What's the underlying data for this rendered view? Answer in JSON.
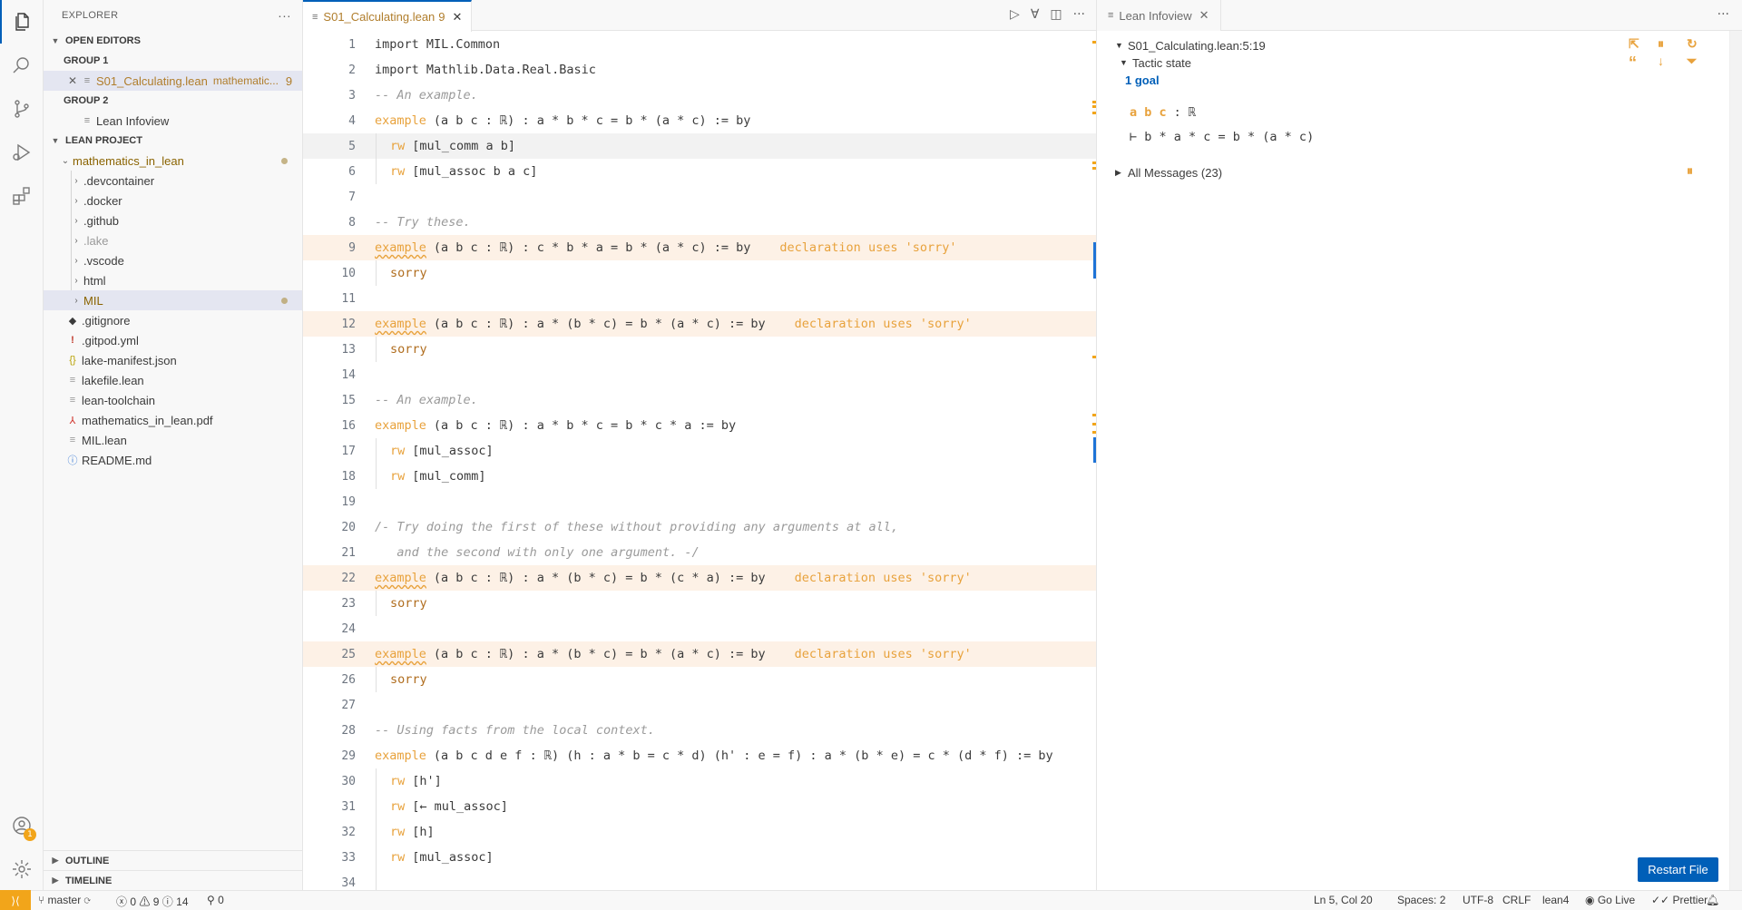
{
  "sidebar": {
    "title": "EXPLORER",
    "more": "···",
    "open_editors": "OPEN EDITORS",
    "group1": "GROUP 1",
    "group1_file": "S01_Calculating.lean",
    "group1_path": "mathematic...",
    "group1_count": "9",
    "group2": "GROUP 2",
    "group2_file": "Lean Infoview",
    "project": "LEAN PROJECT",
    "root_folder": "mathematics_in_lean",
    "items": [
      {
        "label": ".devcontainer",
        "kind": "folder"
      },
      {
        "label": ".docker",
        "kind": "folder"
      },
      {
        "label": ".github",
        "kind": "folder"
      },
      {
        "label": ".lake",
        "kind": "folder"
      },
      {
        "label": ".vscode",
        "kind": "folder"
      },
      {
        "label": "html",
        "kind": "folder"
      },
      {
        "label": "MIL",
        "kind": "folder"
      },
      {
        "label": ".gitignore",
        "kind": "file"
      },
      {
        "label": ".gitpod.yml",
        "kind": "file"
      },
      {
        "label": "lake-manifest.json",
        "kind": "file"
      },
      {
        "label": "lakefile.lean",
        "kind": "file"
      },
      {
        "label": "lean-toolchain",
        "kind": "file"
      },
      {
        "label": "mathematics_in_lean.pdf",
        "kind": "file"
      },
      {
        "label": "MIL.lean",
        "kind": "file"
      },
      {
        "label": "README.md",
        "kind": "file"
      }
    ],
    "outline": "OUTLINE",
    "timeline": "TIMELINE",
    "accounts_badge": "1"
  },
  "editor": {
    "tab_label": "S01_Calculating.lean",
    "tab_count": "9",
    "lines": [
      {
        "n": "1",
        "kind": "import",
        "text": "import MIL.Common"
      },
      {
        "n": "2",
        "kind": "import",
        "text": "import Mathlib.Data.Real.Basic"
      },
      {
        "n": "3",
        "kind": "comment",
        "text": "-- An example."
      },
      {
        "n": "4",
        "kind": "example",
        "text": "(a b c : ℝ) : a * b * c = b * (a * c) := by"
      },
      {
        "n": "5",
        "kind": "tactic",
        "text": "[mul_comm a b]"
      },
      {
        "n": "6",
        "kind": "tactic",
        "text": "[mul_assoc b a c]"
      },
      {
        "n": "7",
        "kind": "blank",
        "text": ""
      },
      {
        "n": "8",
        "kind": "comment",
        "text": "-- Try these."
      },
      {
        "n": "9",
        "kind": "sorry_example",
        "text": "(a b c : ℝ) : c * b * a = b * (a * c) := by"
      },
      {
        "n": "10",
        "kind": "sorry",
        "text": "sorry"
      },
      {
        "n": "11",
        "kind": "blank",
        "text": ""
      },
      {
        "n": "12",
        "kind": "sorry_example",
        "text": "(a b c : ℝ) : a * (b * c) = b * (a * c) := by"
      },
      {
        "n": "13",
        "kind": "sorry",
        "text": "sorry"
      },
      {
        "n": "14",
        "kind": "blank",
        "text": ""
      },
      {
        "n": "15",
        "kind": "comment",
        "text": "-- An example."
      },
      {
        "n": "16",
        "kind": "example",
        "text": "(a b c : ℝ) : a * b * c = b * c * a := by"
      },
      {
        "n": "17",
        "kind": "tactic",
        "text": "[mul_assoc]"
      },
      {
        "n": "18",
        "kind": "tactic",
        "text": "[mul_comm]"
      },
      {
        "n": "19",
        "kind": "blank",
        "text": ""
      },
      {
        "n": "20",
        "kind": "comment",
        "text": "/- Try doing the first of these without providing any arguments at all,"
      },
      {
        "n": "21",
        "kind": "comment",
        "text": "   and the second with only one argument. -/"
      },
      {
        "n": "22",
        "kind": "sorry_example",
        "text": "(a b c : ℝ) : a * (b * c) = b * (c * a) := by"
      },
      {
        "n": "23",
        "kind": "sorry",
        "text": "sorry"
      },
      {
        "n": "24",
        "kind": "blank",
        "text": ""
      },
      {
        "n": "25",
        "kind": "sorry_example",
        "text": "(a b c : ℝ) : a * (b * c) = b * (a * c) := by"
      },
      {
        "n": "26",
        "kind": "sorry",
        "text": "sorry"
      },
      {
        "n": "27",
        "kind": "blank",
        "text": ""
      },
      {
        "n": "28",
        "kind": "comment",
        "text": "-- Using facts from the local context."
      },
      {
        "n": "29",
        "kind": "example",
        "text": "(a b c d e f : ℝ) (h : a * b = c * d) (h' : e = f) : a * (b * e) = c * (d * f) := by"
      },
      {
        "n": "30",
        "kind": "tactic",
        "text": "[h']"
      },
      {
        "n": "31",
        "kind": "tactic",
        "text": "[← mul_assoc]"
      },
      {
        "n": "32",
        "kind": "tactic",
        "text": "[h]"
      },
      {
        "n": "33",
        "kind": "tactic",
        "text": "[mul_assoc]"
      },
      {
        "n": "34",
        "kind": "blank",
        "text": ""
      }
    ],
    "keyword_example": "example",
    "keyword_rw": "rw",
    "inline_warning": "declaration uses 'sorry'"
  },
  "infoview": {
    "tab_label": "Lean Infoview",
    "position": "S01_Calculating.lean:5:19",
    "tactic_state": "Tactic state",
    "goal_count": "1 goal",
    "hyp_vars": "a b c",
    "hyp_type": ": ℝ",
    "goal": "⊢ b * a * c = b * (a * c)",
    "all_messages": "All Messages (23)",
    "restart_button": "Restart File"
  },
  "status": {
    "branch": "master",
    "errors": "0",
    "warnings": "9",
    "infos": "14",
    "ports": "0",
    "cursor": "Ln 5, Col 20",
    "spaces": "Spaces: 2",
    "encoding": "UTF-8",
    "eol": "CRLF",
    "language": "lean4",
    "go_live": "Go Live",
    "prettier": "Prettier"
  },
  "colors": {
    "accent": "#005fb8",
    "warning": "#e8a23c",
    "remote": "#f2a51a"
  }
}
